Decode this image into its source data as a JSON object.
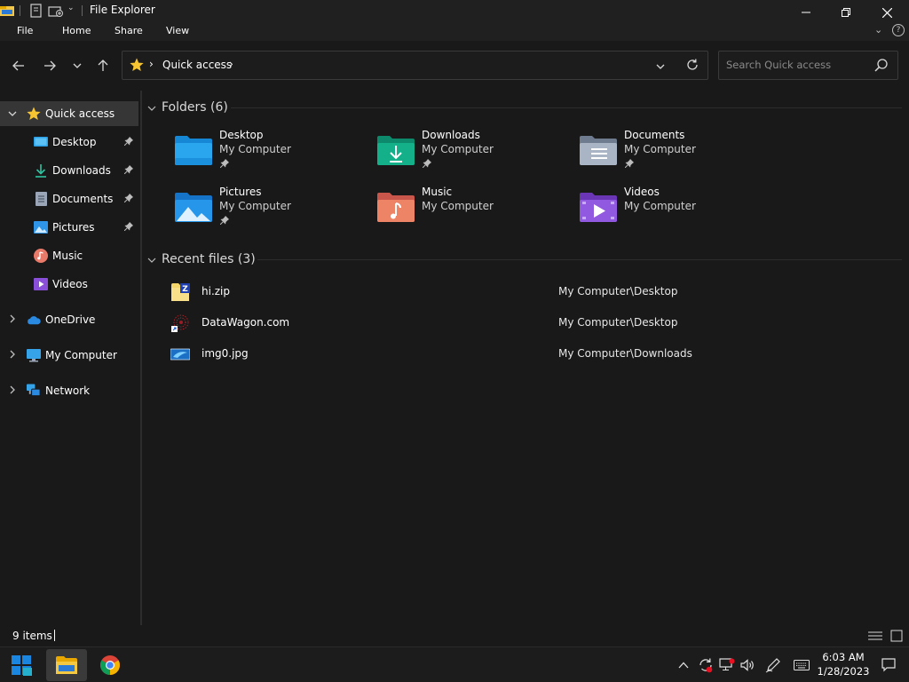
{
  "window": {
    "title": "File Explorer"
  },
  "ribbon": {
    "tabs": [
      "File",
      "Home",
      "Share",
      "View"
    ]
  },
  "address": {
    "location": "Quick access"
  },
  "search": {
    "placeholder": "Search Quick access"
  },
  "sidebar": {
    "quick_access": "Quick access",
    "items": [
      {
        "label": "Desktop",
        "pinned": true,
        "icon": "desktop-icon"
      },
      {
        "label": "Downloads",
        "pinned": true,
        "icon": "download-icon"
      },
      {
        "label": "Documents",
        "pinned": true,
        "icon": "documents-icon"
      },
      {
        "label": "Pictures",
        "pinned": true,
        "icon": "pictures-icon"
      },
      {
        "label": "Music",
        "pinned": false,
        "icon": "music-icon"
      },
      {
        "label": "Videos",
        "pinned": false,
        "icon": "videos-icon"
      }
    ],
    "onedrive": "OneDrive",
    "my_computer": "My Computer",
    "network": "Network"
  },
  "folders": {
    "header": "Folders (6)",
    "items": [
      {
        "name": "Desktop",
        "location": "My Computer",
        "pinned": true,
        "icon": "desktop-folder-icon",
        "color": "#1a9be0"
      },
      {
        "name": "Downloads",
        "location": "My Computer",
        "pinned": true,
        "icon": "downloads-folder-icon",
        "color": "#10a37f"
      },
      {
        "name": "Documents",
        "location": "My Computer",
        "pinned": true,
        "icon": "documents-folder-icon",
        "color": "#8e9cb1"
      },
      {
        "name": "Pictures",
        "location": "My Computer",
        "pinned": true,
        "icon": "pictures-folder-icon",
        "color": "#1d8fe0"
      },
      {
        "name": "Music",
        "location": "My Computer",
        "pinned": false,
        "icon": "music-folder-icon",
        "color": "#e0695a"
      },
      {
        "name": "Videos",
        "location": "My Computer",
        "pinned": false,
        "icon": "videos-folder-icon",
        "color": "#8a4fd8"
      }
    ]
  },
  "recent": {
    "header": "Recent files (3)",
    "items": [
      {
        "name": "hi.zip",
        "path": "My Computer\\Desktop",
        "icon": "zip-file-icon"
      },
      {
        "name": "DataWagon.com",
        "path": "My Computer\\Desktop",
        "icon": "shortcut-icon"
      },
      {
        "name": "img0.jpg",
        "path": "My Computer\\Downloads",
        "icon": "image-file-icon"
      }
    ]
  },
  "status": {
    "item_count": "9 items"
  },
  "taskbar": {
    "time": "6:03 AM",
    "date": "1/28/2023"
  },
  "colors": {
    "accent": "#0078d4",
    "folder_yellow": "#f3c74a",
    "star": "#f7c531"
  }
}
